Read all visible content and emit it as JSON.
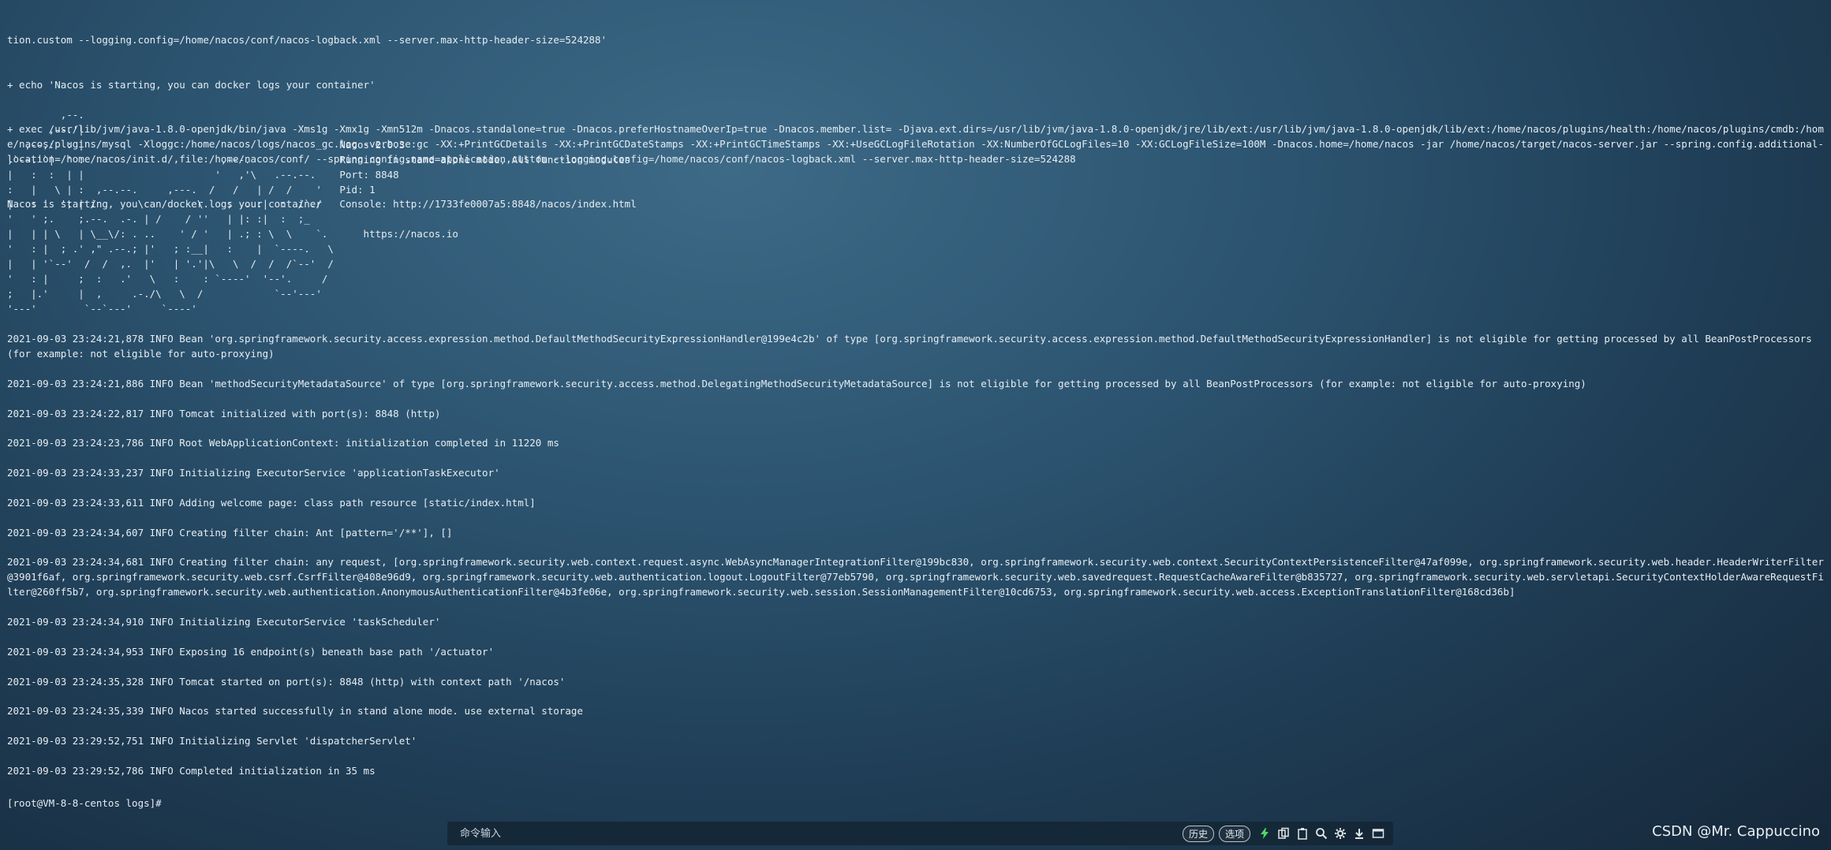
{
  "header_lines": [
    "tion.custom --logging.config=/home/nacos/conf/nacos-logback.xml --server.max-http-header-size=524288'",
    "+ echo 'Nacos is starting, you can docker logs your container'",
    "+ exec /usr/lib/jvm/java-1.8.0-openjdk/bin/java -Xms1g -Xmx1g -Xmn512m -Dnacos.standalone=true -Dnacos.preferHostnameOverIp=true -Dnacos.member.list= -Djava.ext.dirs=/usr/lib/jvm/java-1.8.0-openjdk/jre/lib/ext:/usr/lib/jvm/java-1.8.0-openjdk/lib/ext:/home/nacos/plugins/health:/home/nacos/plugins/cmdb:/home/nacos/plugins/mysql -Xloggc:/home/nacos/logs/nacos_gc.log -verbose:gc -XX:+PrintGCDetails -XX:+PrintGCDateStamps -XX:+PrintGCTimeStamps -XX:+UseGCLogFileRotation -XX:NumberOfGCLogFiles=10 -XX:GCLogFileSize=100M -Dnacos.home=/home/nacos -jar /home/nacos/target/nacos-server.jar --spring.config.additional-location=/home/nacos/init.d/,file:/home/nacos/conf/ --spring.config.name=application,custom --logging.config=/home/nacos/conf/nacos-logback.xml --server.max-http-header-size=524288",
    "Nacos is starting, you can docker logs your container"
  ],
  "ascii_banner": "         ,--.\n       ,--.'|\n   ,--,:  : |                                           Nacos 2.0.3\n,`--.'`|  ' :                       ,---.               Running in stand alone mode, All function modules\n|   :  :  | |                      '   ,'\\   .--.--.    Port: 8848\n:   |   \\ | :  ,--.--.     ,---.  /   /   | /  /    '   Pid: 1\n|   : '  '; | /       \\   /     \\.   ; ,. :|  :  /`./   Console: http://1733fe0007a5:8848/nacos/index.html\n'   ' ;.    ;.--.  .-. | /    / ''   | |: :|  :  ;_\n|   | | \\   | \\__\\/: . ..    ' / '   | .; : \\  \\    `.      https://nacos.io\n'   : |  ; .' ,\" .--.; |'   ; :__|   :    |  `----.   \\\n|   | '`--'  /  /  ,.  |'   | '.'|\\   \\  /  /  /`--'  /\n'   : |     ;  :   .'   \\   :    : `----'  '--'.     /\n;   |.'     |  ,     .-./\\   \\  /            `--'---'\n'---'        `--`---'     `----'",
  "log_entries": [
    "2021-09-03 23:24:21,878 INFO Bean 'org.springframework.security.access.expression.method.DefaultMethodSecurityExpressionHandler@199e4c2b' of type [org.springframework.security.access.expression.method.DefaultMethodSecurityExpressionHandler] is not eligible for getting processed by all BeanPostProcessors (for example: not eligible for auto-proxying)",
    "2021-09-03 23:24:21,886 INFO Bean 'methodSecurityMetadataSource' of type [org.springframework.security.access.method.DelegatingMethodSecurityMetadataSource] is not eligible for getting processed by all BeanPostProcessors (for example: not eligible for auto-proxying)",
    "2021-09-03 23:24:22,817 INFO Tomcat initialized with port(s): 8848 (http)",
    "2021-09-03 23:24:23,786 INFO Root WebApplicationContext: initialization completed in 11220 ms",
    "2021-09-03 23:24:33,237 INFO Initializing ExecutorService 'applicationTaskExecutor'",
    "2021-09-03 23:24:33,611 INFO Adding welcome page: class path resource [static/index.html]",
    "2021-09-03 23:24:34,607 INFO Creating filter chain: Ant [pattern='/**'], []",
    "2021-09-03 23:24:34,681 INFO Creating filter chain: any request, [org.springframework.security.web.context.request.async.WebAsyncManagerIntegrationFilter@199bc830, org.springframework.security.web.context.SecurityContextPersistenceFilter@47af099e, org.springframework.security.web.header.HeaderWriterFilter@3901f6af, org.springframework.security.web.csrf.CsrfFilter@408e96d9, org.springframework.security.web.authentication.logout.LogoutFilter@77eb5790, org.springframework.security.web.savedrequest.RequestCacheAwareFilter@b835727, org.springframework.security.web.servletapi.SecurityContextHolderAwareRequestFilter@260ff5b7, org.springframework.security.web.authentication.AnonymousAuthenticationFilter@4b3fe06e, org.springframework.security.web.session.SessionManagementFilter@10cd6753, org.springframework.security.web.access.ExceptionTranslationFilter@168cd36b]",
    "2021-09-03 23:24:34,910 INFO Initializing ExecutorService 'taskScheduler'",
    "2021-09-03 23:24:34,953 INFO Exposing 16 endpoint(s) beneath base path '/actuator'",
    "2021-09-03 23:24:35,328 INFO Tomcat started on port(s): 8848 (http) with context path '/nacos'",
    "2021-09-03 23:24:35,339 INFO Nacos started successfully in stand alone mode. use external storage",
    "2021-09-03 23:29:52,751 INFO Initializing Servlet 'dispatcherServlet'",
    "2021-09-03 23:29:52,786 INFO Completed initialization in 35 ms"
  ],
  "prompt": "[root@VM-8-8-centos logs]#",
  "command_bar": {
    "placeholder": "命令输入",
    "history_label": "历史",
    "options_label": "选项",
    "icons": [
      "lightning-icon",
      "copy-icon",
      "paste-icon",
      "search-icon",
      "gear-icon",
      "download-icon",
      "window-icon"
    ]
  },
  "watermark": "CSDN @Mr. Cappuccino",
  "colors": {
    "accent_green": "#4cd964",
    "text": "#e6edf2"
  }
}
